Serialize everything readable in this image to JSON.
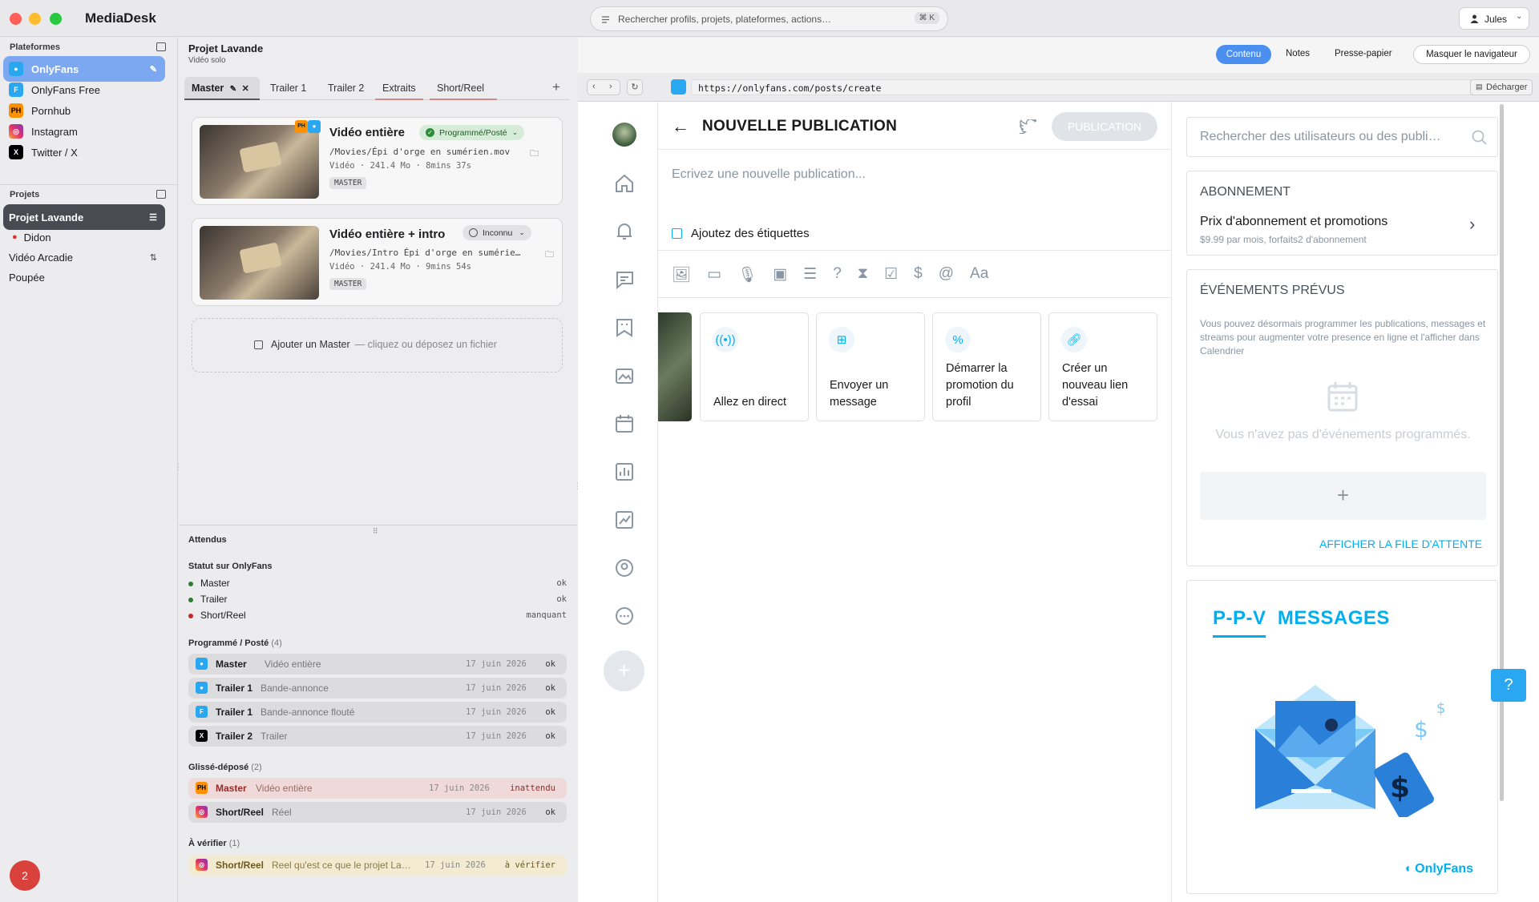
{
  "app": {
    "name": "MediaDesk",
    "search_placeholder": "Rechercher profils, projets, plateformes, actions…",
    "search_shortcut": "⌘ K",
    "user": "Jules",
    "notifications": "2"
  },
  "sidebar": {
    "platforms_title": "Plateformes",
    "platforms": [
      {
        "label": "OnlyFans"
      },
      {
        "label": "OnlyFans Free"
      },
      {
        "label": "Pornhub"
      },
      {
        "label": "Instagram"
      },
      {
        "label": "Twitter / X"
      }
    ],
    "projects_title": "Projets",
    "projects": [
      {
        "label": "Projet Lavande"
      },
      {
        "label": "Didon"
      },
      {
        "label": "Vidéo Arcadie"
      },
      {
        "label": "Poupée"
      }
    ]
  },
  "project": {
    "title": "Projet Lavande",
    "subtitle": "Vidéo solo",
    "tabs": [
      {
        "label": "Master"
      },
      {
        "label": "Trailer 1"
      },
      {
        "label": "Trailer 2"
      },
      {
        "label": "Extraits"
      },
      {
        "label": "Short/Reel"
      }
    ],
    "cards": [
      {
        "title": "Vidéo entière",
        "status": "Programmé/Posté",
        "path": "/Movies/Épi d'orge en sumérien.mov",
        "meta": "Vidéo · 241.4 Mo · 8mins 37s",
        "tag": "MASTER"
      },
      {
        "title": "Vidéo entière + intro",
        "status": "Inconnu",
        "path": "/Movies/Intro Épi d'orge en sumérie…",
        "meta": "Vidéo · 241.4 Mo · 9mins 54s",
        "tag": "MASTER"
      }
    ],
    "add_master": "Ajouter un Master",
    "add_master_hint": "— cliquez ou déposez un fichier"
  },
  "expected": {
    "title": "Attendus",
    "status_title": "Statut sur OnlyFans",
    "status": [
      {
        "label": "Master",
        "value": "ok",
        "color": "#2e7d32"
      },
      {
        "label": "Trailer",
        "value": "ok",
        "color": "#2e7d32"
      },
      {
        "label": "Short/Reel",
        "value": "manquant",
        "color": "#c62828"
      }
    ],
    "scheduled_title": "Programmé / Posté",
    "scheduled_count": "(4)",
    "scheduled": [
      {
        "name": "Master",
        "desc": "Vidéo entière",
        "date": "17 juin 2026",
        "state": "ok"
      },
      {
        "name": "Trailer 1",
        "desc": "Bande-annonce",
        "date": "17 juin 2026",
        "state": "ok"
      },
      {
        "name": "Trailer 1",
        "desc": "Bande-annonce flouté",
        "date": "17 juin 2026",
        "state": "ok"
      },
      {
        "name": "Trailer 2",
        "desc": "Trailer",
        "date": "17 juin 2026",
        "state": "ok"
      }
    ],
    "dropped_title": "Glissé-déposé",
    "dropped_count": "(2)",
    "dropped": [
      {
        "name": "Master",
        "desc": "Vidéo entière",
        "date": "17 juin 2026",
        "state": "inattendu"
      },
      {
        "name": "Short/Reel",
        "desc": "Réel",
        "date": "17 juin 2026",
        "state": "ok"
      }
    ],
    "verify_title": "À vérifier",
    "verify_count": "(1)",
    "verify": [
      {
        "name": "Short/Reel",
        "desc": "Reel qu'est ce que le projet La…",
        "date": "17 juin 2026",
        "state": "à vérifier"
      }
    ]
  },
  "browser": {
    "tabs": [
      {
        "label": "Contenu"
      },
      {
        "label": "Notes"
      },
      {
        "label": "Presse-papier"
      }
    ],
    "hide": "Masquer le navigateur",
    "url": "https://onlyfans.com/posts/create",
    "unload": "Décharger"
  },
  "of": {
    "title": "NOUVELLE PUBLICATION",
    "publish": "PUBLICATION",
    "placeholder": "Ecrivez une nouvelle publication...",
    "tags": "Ajoutez des étiquettes",
    "actions": [
      {
        "label": "Allez en direct"
      },
      {
        "label": "Envoyer un message"
      },
      {
        "label": "Démarrer la promotion du profil"
      },
      {
        "label": "Créer un nouveau lien d'essai"
      }
    ],
    "search": "Rechercher des utilisateurs ou des publi…",
    "sub_title": "ABONNEMENT",
    "sub_label": "Prix d'abonnement et promotions",
    "sub_detail": "$9.99 par mois, forfaits2 d'abonnement",
    "events_title": "ÉVÉNEMENTS PRÉVUS",
    "events_desc": "Vous pouvez désormais programmer les publications, messages et streams pour augmenter votre presence en ligne et l'afficher dans Calendrier",
    "events_empty": "Vous n'avez pas d'événements programmés.",
    "queue": "AFFICHER LA FILE D'ATTENTE",
    "ppv_title": "P-P-V  MESSAGES",
    "brand": "OnlyFans",
    "accent": "#00aff0"
  }
}
